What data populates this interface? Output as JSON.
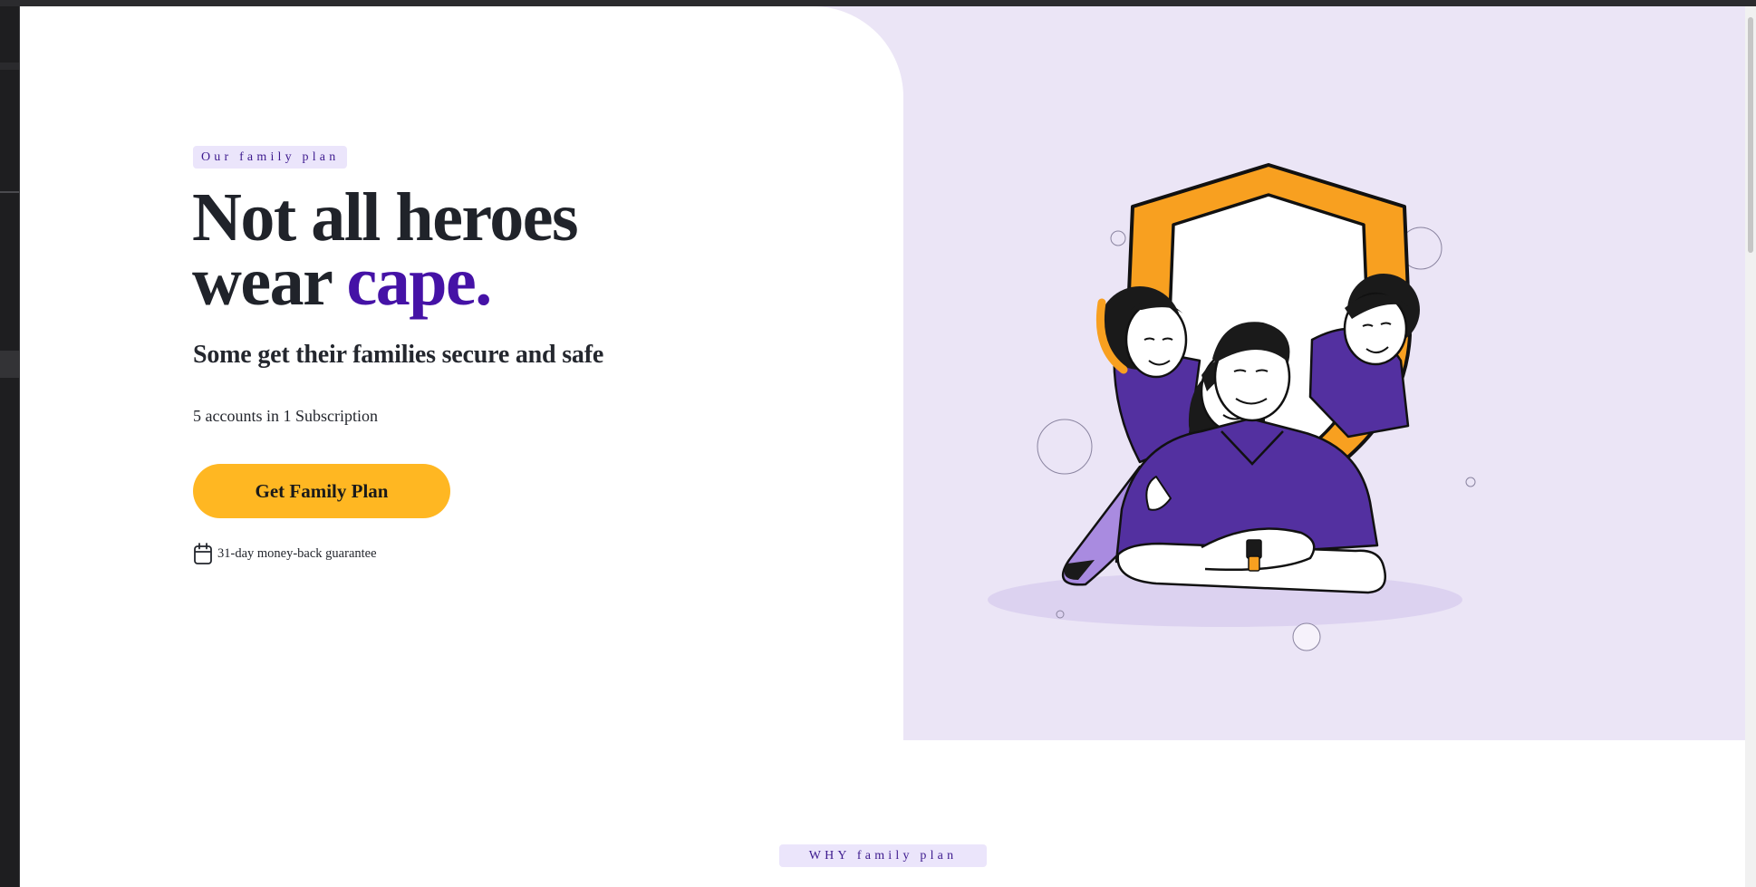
{
  "hero": {
    "eyebrow": "Our family plan",
    "headline_line1": "Not all heroes",
    "headline_line2_prefix": "wear ",
    "headline_accent": "cape.",
    "subhead": "Some get their families secure and safe",
    "accounts_text": "5 accounts in 1 Subscription",
    "cta_label": "Get Family Plan",
    "guarantee_text": "31-day money-back guarantee",
    "guarantee_icon": "calendar-icon",
    "illustration": "family-with-shield-illustration"
  },
  "why_section": {
    "eyebrow": "WHY family plan"
  },
  "colors": {
    "accent_purple": "#4512a6",
    "cta_yellow": "#ffb722",
    "hero_art_background": "#ebe5f6",
    "eyebrow_background": "#ebe5fb",
    "shield_orange": "#f8a020",
    "shirt_purple": "#5330a0",
    "light_purple": "#a98be0"
  }
}
